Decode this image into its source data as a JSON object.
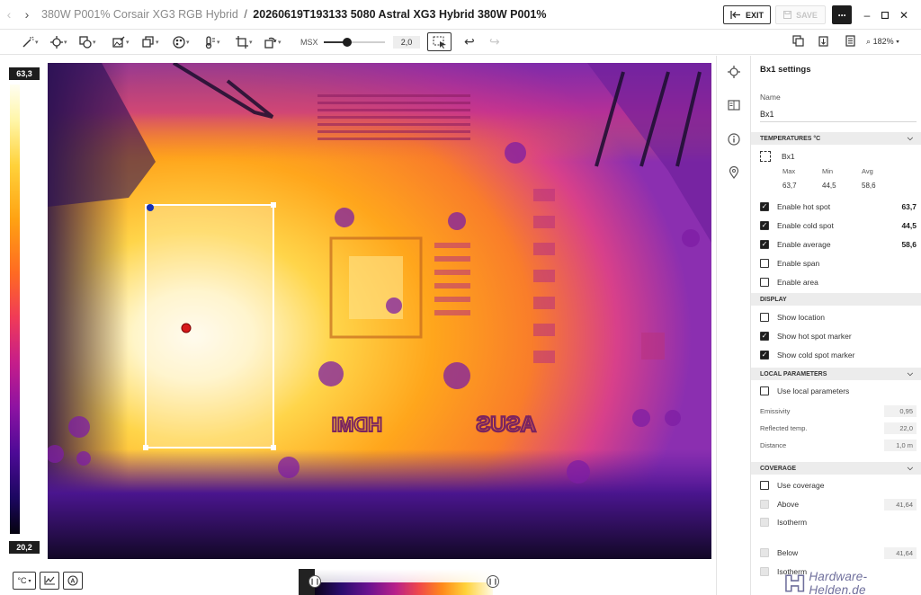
{
  "titlebar": {
    "back_icon": "chevron-left-icon",
    "forward_icon": "chevron-right-icon",
    "folder_name": "380W P001% Corsair XG3 RGB Hybrid",
    "separator": "/",
    "file_name": "20260619T193133 5080 Astral XG3 Hybrid 380W P001%",
    "exit_label": "EXIT",
    "save_label": "SAVE",
    "more_label": "···"
  },
  "toolbar": {
    "msx_label": "MSX",
    "msx_value": "2,0",
    "msx_fraction": 0.38,
    "zoom": "182%"
  },
  "scale": {
    "max": "63,3",
    "min": "20,2"
  },
  "panel": {
    "title": "Bx1 settings",
    "name_label": "Name",
    "name_value": "Bx1",
    "sections": {
      "temperatures": "TEMPERATURES °C",
      "display": "DISPLAY",
      "local_parameters": "LOCAL PARAMETERS",
      "coverage": "COVERAGE"
    },
    "measurement": {
      "name": "Bx1",
      "max_label": "Max",
      "min_label": "Min",
      "avg_label": "Avg",
      "max": "63,7",
      "min": "44,5",
      "avg": "58,6"
    },
    "temp_options": [
      {
        "label": "Enable hot spot",
        "checked": true,
        "value": "63,7"
      },
      {
        "label": "Enable cold spot",
        "checked": true,
        "value": "44,5"
      },
      {
        "label": "Enable average",
        "checked": true,
        "value": "58,6"
      },
      {
        "label": "Enable span",
        "checked": false,
        "value": ""
      },
      {
        "label": "Enable area",
        "checked": false,
        "value": ""
      }
    ],
    "display_options": [
      {
        "label": "Show location",
        "checked": false
      },
      {
        "label": "Show hot spot marker",
        "checked": true
      },
      {
        "label": "Show cold spot marker",
        "checked": true
      }
    ],
    "local": {
      "use_label": "Use local parameters",
      "emissivity_label": "Emissivity",
      "emissivity": "0,95",
      "reflected_label": "Reflected temp.",
      "reflected": "22,0",
      "distance_label": "Distance",
      "distance": "1,0 m"
    },
    "coverage": {
      "use_label": "Use coverage",
      "above_label": "Above",
      "above_value": "41,64",
      "isotherm_label": "Isotherm",
      "below_label": "Below",
      "below_value": "41,64",
      "isotherm2_label": "Isotherm"
    }
  },
  "bottom": {
    "unit_label": "°C",
    "hist_left_icon": "pause-icon",
    "hist_right_icon": "pause-icon"
  },
  "watermark": {
    "text": "Hardware-Helden.de"
  },
  "image_labels": {
    "hdmi": "HDMI",
    "asus": "ASUS"
  },
  "colors": {
    "accent": "#1d1d1d",
    "section_bg": "#ececec",
    "hot_marker": "#d61a1a",
    "cold_marker": "#1430b8",
    "watermark": "#6f6f9c"
  }
}
